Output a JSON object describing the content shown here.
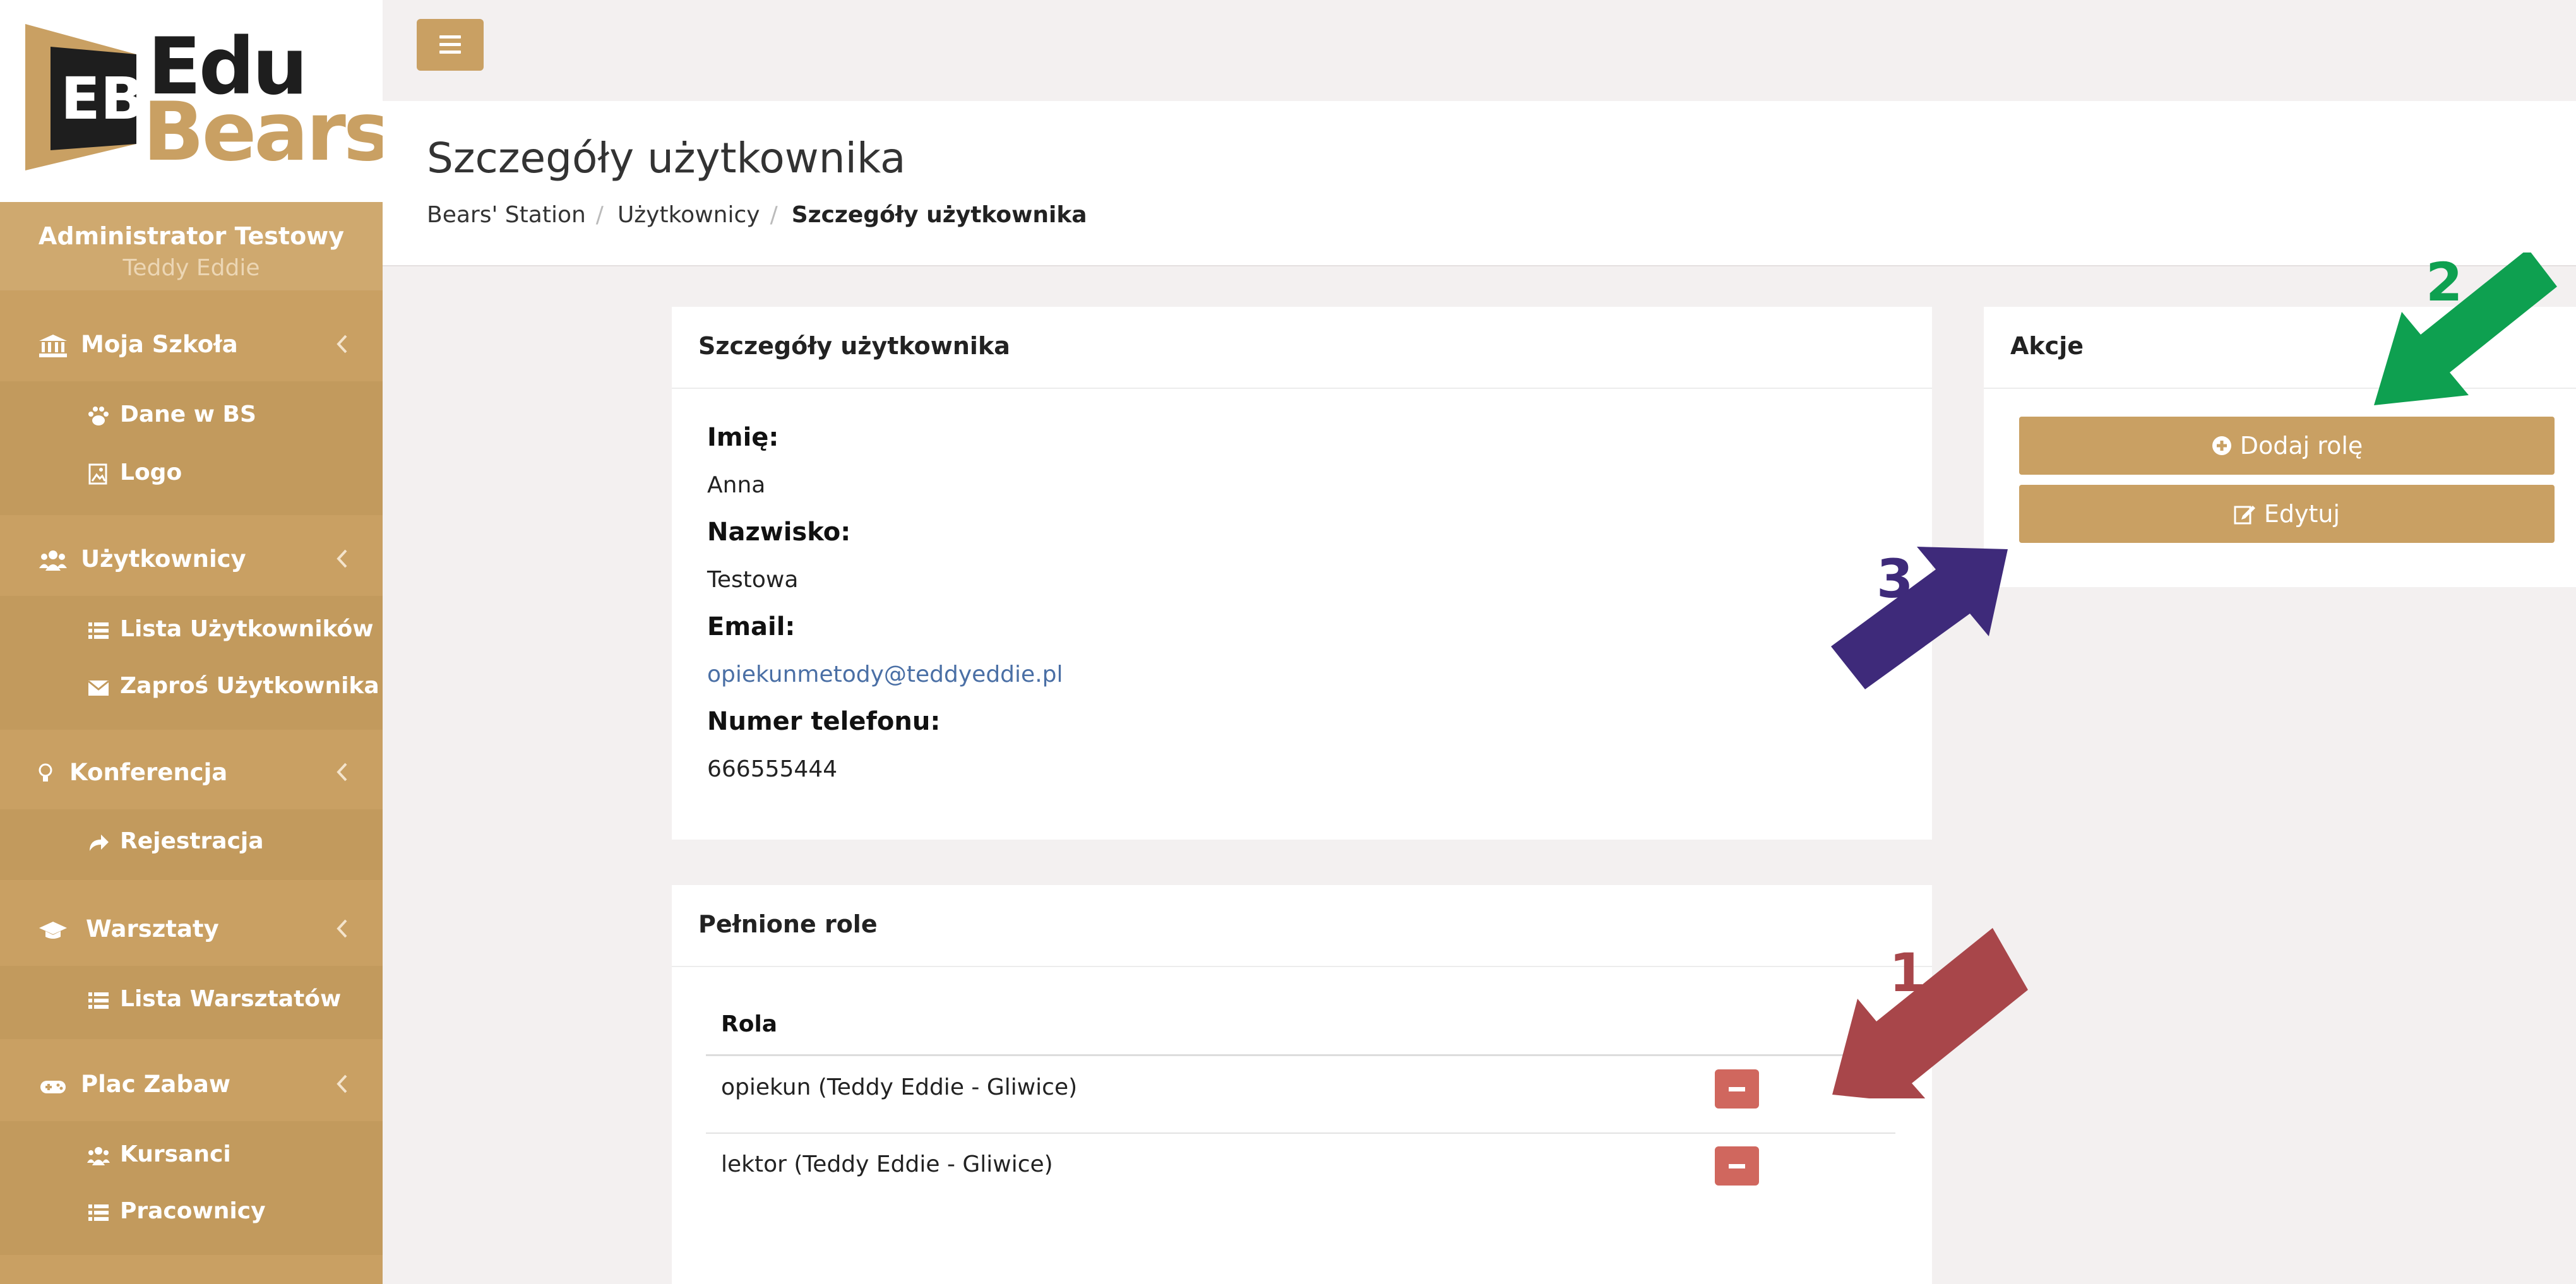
{
  "logo": {
    "line1": "Edu",
    "line2": "Bears",
    "mark_letters": "EB"
  },
  "user": {
    "name": "Administrator Testowy",
    "organization": "Teddy Eddie"
  },
  "sidebar": {
    "sections": [
      {
        "label": "Moja Szkoła",
        "icon": "bank-icon",
        "items": [
          {
            "label": "Dane w BS",
            "icon": "paw-icon"
          },
          {
            "label": "Logo",
            "icon": "image-icon"
          }
        ]
      },
      {
        "label": "Użytkownicy",
        "icon": "users-icon",
        "items": [
          {
            "label": "Lista Użytkowników",
            "icon": "list-icon"
          },
          {
            "label": "Zaproś Użytkownika",
            "icon": "envelope-icon"
          }
        ]
      },
      {
        "label": "Konferencja",
        "icon": "lightbulb-icon",
        "items": [
          {
            "label": "Rejestracja",
            "icon": "share-icon"
          }
        ]
      },
      {
        "label": "Warsztaty",
        "icon": "graduation-cap-icon",
        "items": [
          {
            "label": "Lista Warsztatów",
            "icon": "list-icon"
          }
        ]
      },
      {
        "label": "Plac Zabaw",
        "icon": "gamepad-icon",
        "items": [
          {
            "label": "Kursanci",
            "icon": "users-icon"
          },
          {
            "label": "Pracownicy",
            "icon": "list-icon"
          }
        ]
      }
    ]
  },
  "header": {
    "title": "Szczegóły użytkownika",
    "breadcrumb": [
      "Bears' Station",
      "Użytkownicy",
      "Szczegóły użytkownika"
    ],
    "separator": "/"
  },
  "details_panel": {
    "title": "Szczegóły użytkownika",
    "fields": [
      {
        "label": "Imię:",
        "value": "Anna"
      },
      {
        "label": "Nazwisko:",
        "value": "Testowa"
      },
      {
        "label": "Email:",
        "value": "opiekunmetody@teddyeddie.pl"
      },
      {
        "label": "Numer telefonu:",
        "value": "666555444"
      }
    ]
  },
  "roles_panel": {
    "title": "Pełnione role",
    "column_header": "Rola",
    "rows": [
      {
        "role": "opiekun (Teddy Eddie - Gliwice)"
      },
      {
        "role": "lektor (Teddy Eddie - Gliwice)"
      }
    ]
  },
  "actions_panel": {
    "title": "Akcje",
    "add_role_label": "Dodaj rolę",
    "edit_label": "Edytuj"
  },
  "annotations": [
    {
      "number": "1",
      "color": "#a8464a"
    },
    {
      "number": "2",
      "color": "#0ea050"
    },
    {
      "number": "3",
      "color": "#3e2a7a"
    }
  ],
  "colors": {
    "brand": "#c9a063",
    "danger": "#d0675e",
    "link": "#4a6fa5"
  }
}
